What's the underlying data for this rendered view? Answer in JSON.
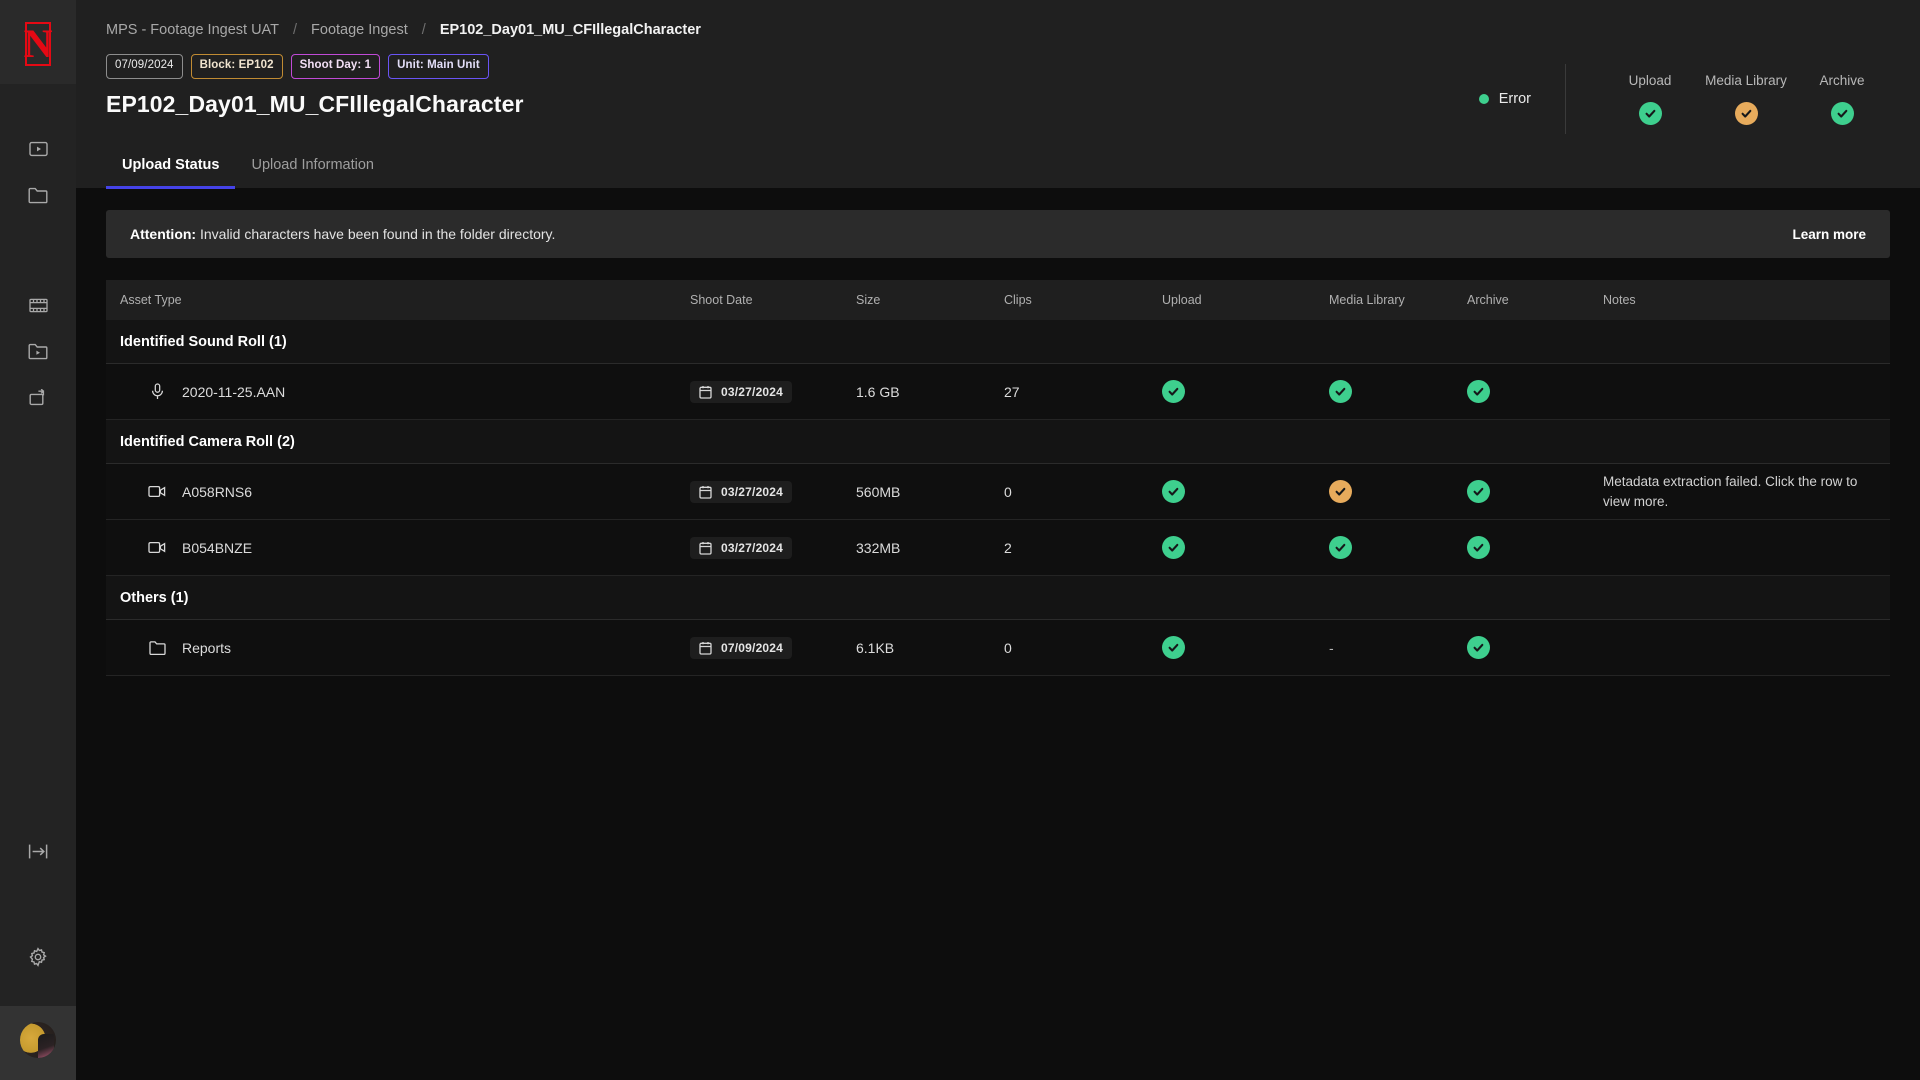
{
  "sidebar": {
    "logo": "netflix-logo",
    "items": [
      {
        "icon": "video-box-icon",
        "name": "sidebar-item-video"
      },
      {
        "icon": "folder-icon",
        "name": "sidebar-item-folder"
      },
      {
        "icon": "filmstrip-icon",
        "name": "sidebar-item-filmstrip"
      },
      {
        "icon": "folder-video-icon",
        "name": "sidebar-item-folder-video"
      },
      {
        "icon": "archive-box-icon",
        "name": "sidebar-item-archive"
      }
    ],
    "collapse_icon": "collapse-panel-icon",
    "settings_icon": "gear-icon",
    "avatar": "user-avatar"
  },
  "header": {
    "breadcrumb": [
      {
        "label": "MPS - Footage Ingest UAT",
        "current": false
      },
      {
        "label": "Footage Ingest",
        "current": false
      },
      {
        "label": "EP102_Day01_MU_CFIllegalCharacter",
        "current": true
      }
    ],
    "breadcrumb_separator": "/",
    "badges": [
      {
        "label": "07/09/2024",
        "kind": "date"
      },
      {
        "label": "Block: EP102",
        "kind": "block"
      },
      {
        "label": "Shoot Day: 1",
        "kind": "shoot"
      },
      {
        "label": "Unit: Main Unit",
        "kind": "unit"
      }
    ],
    "title": "EP102_Day01_MU_CFIllegalCharacter",
    "status": {
      "label": "Error",
      "dot_color": "#3ecf8e"
    },
    "stats": [
      {
        "label": "Upload",
        "state": "green"
      },
      {
        "label": "Media Library",
        "state": "amber"
      },
      {
        "label": "Archive",
        "state": "green"
      }
    ]
  },
  "tabs": [
    {
      "label": "Upload Status",
      "active": true
    },
    {
      "label": "Upload Information",
      "active": false
    }
  ],
  "alert": {
    "strong": "Attention:",
    "message": " Invalid characters have been found in the folder directory.",
    "action": "Learn more"
  },
  "table": {
    "columns": [
      "Asset Type",
      "Shoot Date",
      "Size",
      "Clips",
      "Upload",
      "Media Library",
      "Archive",
      "Notes"
    ],
    "groups": [
      {
        "title": "Identified Sound Roll (1)",
        "rows": [
          {
            "icon": "microphone-icon",
            "asset": "2020-11-25.AAN",
            "date": "03/27/2024",
            "size": "1.6 GB",
            "clips": "27",
            "upload": "green",
            "media": "green",
            "archive": "green",
            "notes": ""
          }
        ]
      },
      {
        "title": "Identified Camera Roll (2)",
        "rows": [
          {
            "icon": "video-camera-icon",
            "asset": "A058RNS6",
            "date": "03/27/2024",
            "size": "560MB",
            "clips": "0",
            "upload": "green",
            "media": "amber",
            "archive": "green",
            "notes": "Metadata extraction failed. Click the row to view more."
          },
          {
            "icon": "video-camera-icon",
            "asset": "B054BNZE",
            "date": "03/27/2024",
            "size": "332MB",
            "clips": "2",
            "upload": "green",
            "media": "green",
            "archive": "green",
            "notes": ""
          }
        ]
      },
      {
        "title": "Others (1)",
        "rows": [
          {
            "icon": "folder-icon",
            "asset": "Reports",
            "date": "07/09/2024",
            "size": "6.1KB",
            "clips": "0",
            "upload": "green",
            "media": "-",
            "archive": "green",
            "notes": ""
          }
        ]
      }
    ]
  },
  "colors": {
    "green": "#3ecf8e",
    "amber": "#e7ab5c",
    "accent": "#4543e8",
    "brand": "#e50914"
  }
}
